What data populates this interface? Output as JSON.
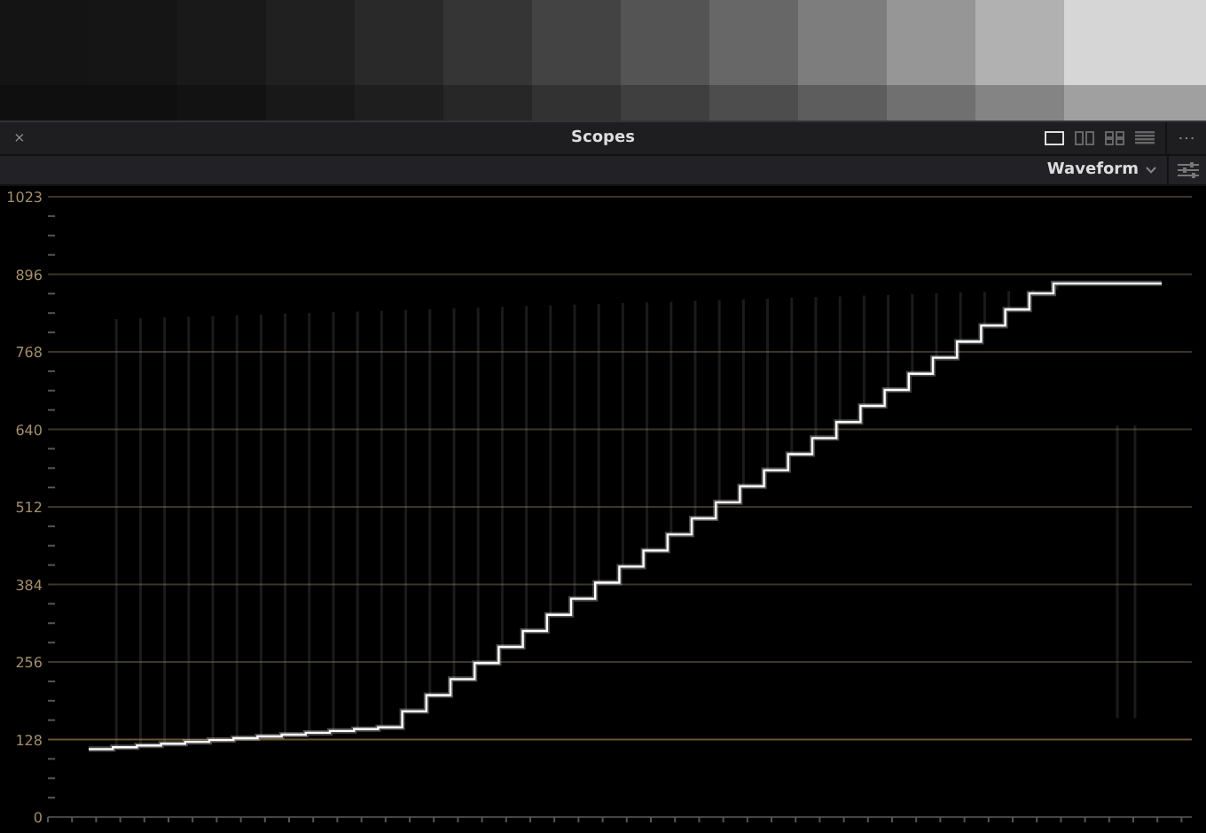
{
  "panel": {
    "close": "×",
    "title": "Scopes",
    "more": "⋯",
    "layouts": [
      {
        "kind": "single",
        "selected": true
      },
      {
        "kind": "dual",
        "selected": false
      },
      {
        "kind": "quad",
        "selected": false
      },
      {
        "kind": "list",
        "selected": false
      }
    ]
  },
  "toolbar": {
    "scope_type": "Waveform"
  },
  "scope": {
    "y_labels": [
      "1023",
      "896",
      "768",
      "640",
      "512",
      "384",
      "256",
      "128",
      "0"
    ]
  }
}
